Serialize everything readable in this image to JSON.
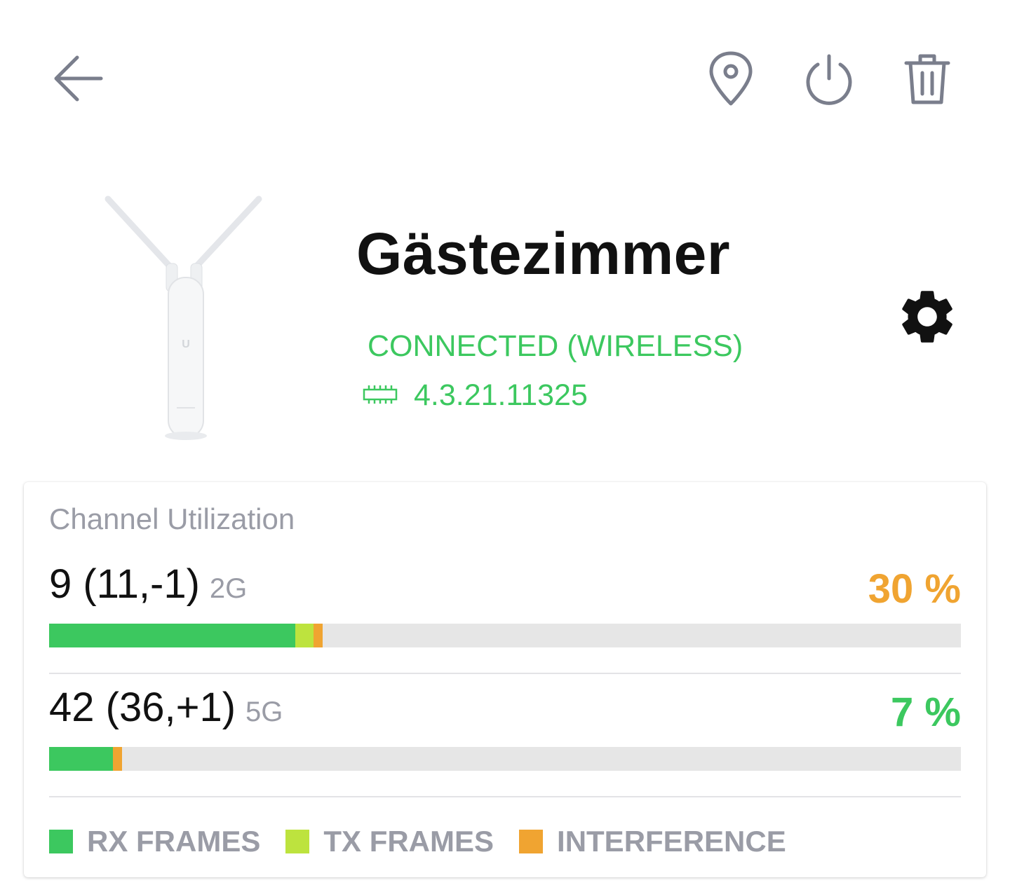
{
  "header": {
    "icons": [
      "arrow-left-icon",
      "map-pin-icon",
      "power-icon",
      "trash-icon"
    ]
  },
  "device": {
    "name": "Gästezimmer",
    "status": "CONNECTED (WIRELESS)",
    "firmware": "4.3.21.11325",
    "status_color": "#3cc85f"
  },
  "channel_utilization": {
    "title": "Channel Utilization",
    "radios": [
      {
        "channel": "9 (11,-1)",
        "band": "2G",
        "percent_label": "30 %",
        "percent_color": "#f0a431",
        "rx": 0.27,
        "tx": 0.02,
        "interference": 0.01
      },
      {
        "channel": "42 (36,+1)",
        "band": "5G",
        "percent_label": "7 %",
        "percent_color": "#3cc85f",
        "rx": 0.07,
        "tx": 0.0,
        "interference": 0.01
      }
    ],
    "legend": [
      {
        "label": "RX FRAMES",
        "color": "#3cc85f"
      },
      {
        "label": "TX FRAMES",
        "color": "#bde33e"
      },
      {
        "label": "INTERFERENCE",
        "color": "#f0a431"
      }
    ]
  }
}
